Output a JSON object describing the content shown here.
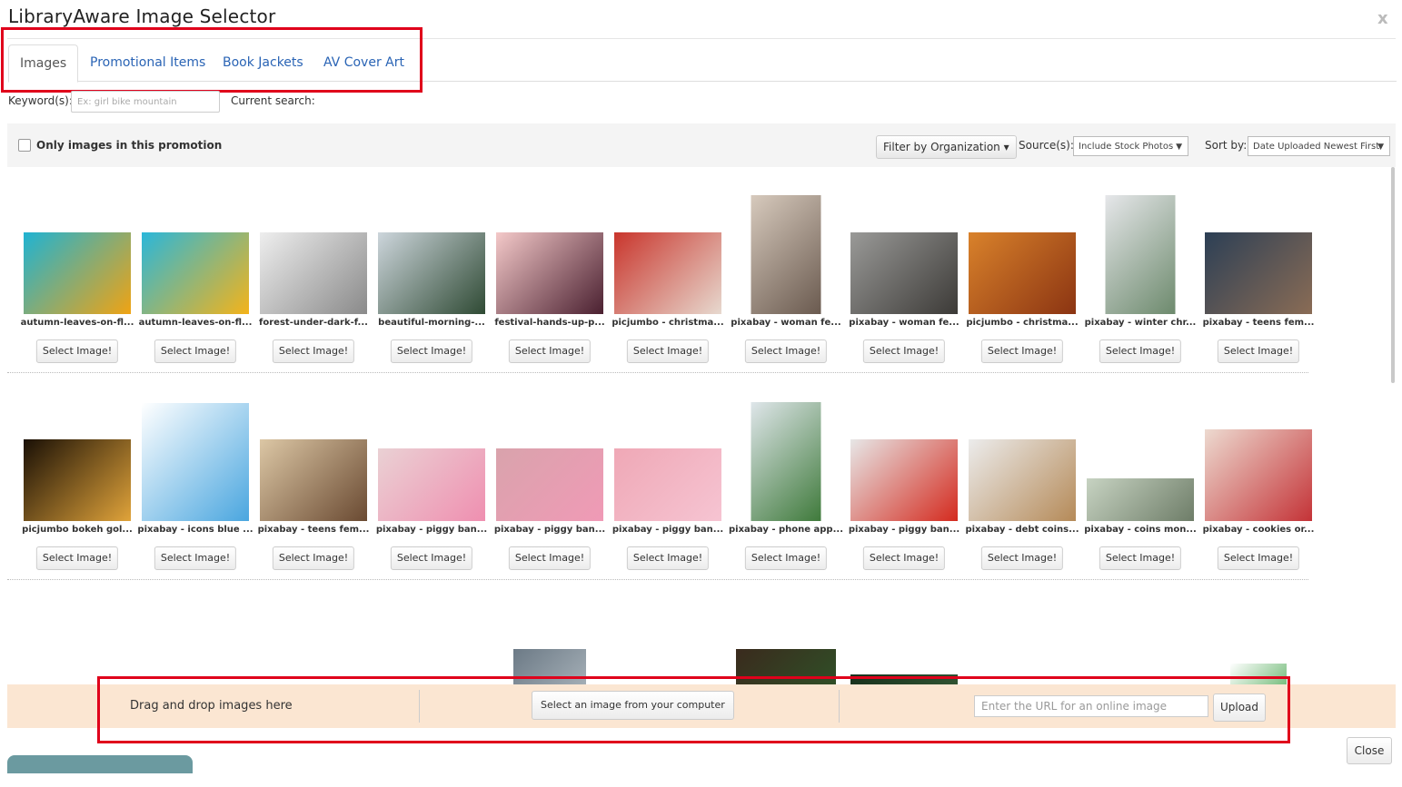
{
  "window": {
    "title": "LibraryAware Image Selector",
    "close_glyph": "x"
  },
  "tabs": [
    {
      "label": "Images",
      "active": true
    },
    {
      "label": "Promotional Items",
      "active": false
    },
    {
      "label": "Book Jackets",
      "active": false
    },
    {
      "label": "AV Cover Art",
      "active": false
    }
  ],
  "search": {
    "keyword_label": "Keyword(s):",
    "placeholder": "Ex: girl bike mountain",
    "current_label": "Current search:"
  },
  "filters": {
    "only_label": "Only images in this promotion",
    "org_button": "Filter by Organization ▾",
    "source_label": "Source(s):",
    "source_value": "Include Stock Photos",
    "sort_label": "Sort by:",
    "sort_value": "Date Uploaded Newest First"
  },
  "select_label": "Select Image!",
  "rows": [
    [
      {
        "caption": "autumn-leaves-on-fl...",
        "c1": "#1fb3d3",
        "c2": "#f0a313"
      },
      {
        "caption": "autumn-leaves-on-fl...",
        "c1": "#2ab7da",
        "c2": "#f4b31a"
      },
      {
        "caption": "forest-under-dark-f...",
        "c1": "#eeeeee",
        "c2": "#8a8a8a"
      },
      {
        "caption": "beautiful-morning-...",
        "c1": "#cdd6dc",
        "c2": "#2f4a34"
      },
      {
        "caption": "festival-hands-up-p...",
        "c1": "#f4c9c9",
        "c2": "#4a2030"
      },
      {
        "caption": "picjumbo - christma...",
        "c1": "#c9352c",
        "c2": "#e7d9cf"
      },
      {
        "caption": "pixabay - woman fe...",
        "c1": "#d7cabd",
        "c2": "#6a5a4f"
      },
      {
        "caption": "pixabay - woman fe...",
        "c1": "#9a9a98",
        "c2": "#3c3a37"
      },
      {
        "caption": "picjumbo - christma...",
        "c1": "#d9822b",
        "c2": "#8b3412"
      },
      {
        "caption": "pixabay - winter chr...",
        "c1": "#e6e7ea",
        "c2": "#6d8a6d"
      },
      {
        "caption": "pixabay - teens fem...",
        "c1": "#2c3f55",
        "c2": "#8a6c55"
      }
    ],
    [
      {
        "caption": "picjumbo bokeh gol...",
        "c1": "#1a1006",
        "c2": "#e0a33a"
      },
      {
        "caption": "pixabay - icons blue ...",
        "c1": "#ffffff",
        "c2": "#4aa6df"
      },
      {
        "caption": "pixabay - teens fem...",
        "c1": "#dcc7a5",
        "c2": "#6a4a32"
      },
      {
        "caption": "pixabay - piggy ban...",
        "c1": "#ead1d4",
        "c2": "#ef8fb0"
      },
      {
        "caption": "pixabay - piggy ban...",
        "c1": "#d9a3ac",
        "c2": "#f09ab6"
      },
      {
        "caption": "pixabay - piggy ban...",
        "c1": "#efa8b6",
        "c2": "#f6c4d2"
      },
      {
        "caption": "pixabay - phone app...",
        "c1": "#dfe6ea",
        "c2": "#3f7a3b"
      },
      {
        "caption": "pixabay - piggy ban...",
        "c1": "#e7e7e7",
        "c2": "#d42a1e"
      },
      {
        "caption": "pixabay - debt coins...",
        "c1": "#ececec",
        "c2": "#b58a58"
      },
      {
        "caption": "pixabay - coins mon...",
        "c1": "#c7d3c2",
        "c2": "#6e7d68"
      },
      {
        "caption": "pixabay - cookies or...",
        "c1": "#eddad0",
        "c2": "#c43337"
      }
    ],
    [
      {
        "caption": "",
        "c1": "#e9e4de",
        "c2": "#8b6a55"
      },
      {
        "caption": "",
        "c1": "#f0e7ad",
        "c2": "#cdb55c"
      },
      {
        "caption": "",
        "c1": "#c9d77a",
        "c2": "#8aa33a"
      },
      {
        "caption": "",
        "c1": "#f2ddc9",
        "c2": "#cf3a2e"
      },
      {
        "caption": "",
        "c1": "#6c7a86",
        "c2": "#b9c2c8"
      },
      {
        "caption": "",
        "c1": "#2f5d2c",
        "c2": "#c43a2c"
      },
      {
        "caption": "",
        "c1": "#3a2a1d",
        "c2": "#2d5a2a"
      },
      {
        "caption": "",
        "c1": "#17301c",
        "c2": "#39603a"
      },
      {
        "caption": "",
        "c1": "#a01818",
        "c2": "#4a1e10"
      },
      {
        "caption": "",
        "c1": "#1a8b78",
        "c2": "#cfe3d8"
      },
      {
        "caption": "",
        "c1": "#ffffff",
        "c2": "#2f9a38"
      }
    ]
  ],
  "upload": {
    "drag_text": "Drag and drop images here",
    "computer_button": "Select an image from your computer",
    "url_placeholder": "Enter the URL for an online image",
    "upload_button": "Upload"
  },
  "footer": {
    "close_button": "Close"
  },
  "colors": {
    "link": "#2a64b5",
    "highlight": "#e0001b",
    "dropzone": "#fbe6d2"
  }
}
